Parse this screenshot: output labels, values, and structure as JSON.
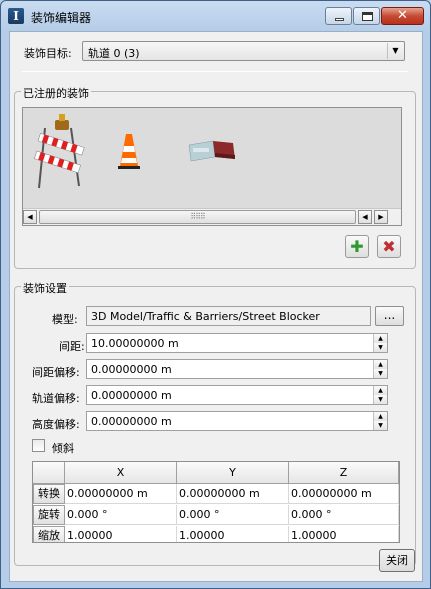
{
  "window": {
    "title": "装饰编辑器",
    "close_glyph": "✕"
  },
  "target": {
    "label": "装饰目标:",
    "value": "轨道 0 (3)"
  },
  "registered": {
    "group_title": "已注册的装饰",
    "items": [
      "street-barrier-icon",
      "traffic-cone-icon",
      "street-blocker-icon"
    ]
  },
  "settings": {
    "group_title": "装饰设置",
    "model_label": "模型:",
    "model_value": "3D Model/Traffic & Barriers/Street Blocker",
    "browse_label": "...",
    "spacing_label": "间距:",
    "spacing_value": "10.00000000 m",
    "spacing_offset_label": "间距偏移:",
    "spacing_offset_value": "0.00000000 m",
    "track_offset_label": "轨道偏移:",
    "track_offset_value": "0.00000000 m",
    "height_offset_label": "高度偏移:",
    "height_offset_value": "0.00000000 m",
    "tilt_label": "倾斜"
  },
  "transform": {
    "headers": [
      "X",
      "Y",
      "Z"
    ],
    "rows": [
      {
        "label": "转换",
        "values": [
          "0.00000000 m",
          "0.00000000 m",
          "0.00000000 m"
        ]
      },
      {
        "label": "旋转",
        "values": [
          "0.000 °",
          "0.000 °",
          "0.000 °"
        ]
      },
      {
        "label": "缩放",
        "values": [
          "1.00000",
          "1.00000",
          "1.00000"
        ]
      }
    ]
  },
  "close_button": "关闭",
  "colors": {
    "add": "#2e9a2e",
    "remove": "#c03030",
    "cone": "#ff6a00"
  }
}
